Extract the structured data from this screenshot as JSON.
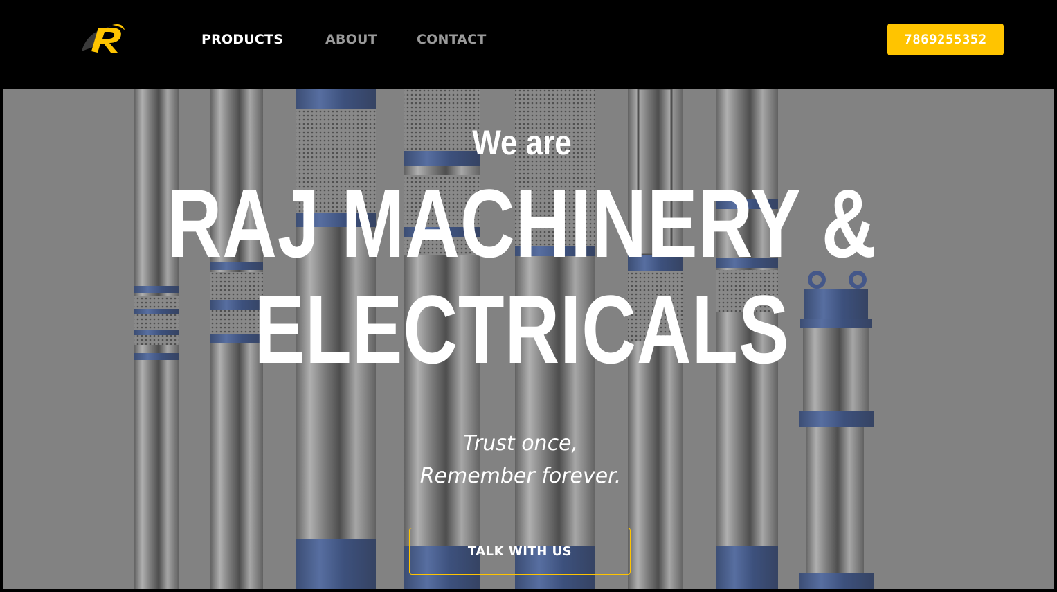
{
  "brand": {
    "logo_letter": "R",
    "accent_color": "#ffc400"
  },
  "nav": {
    "items": [
      {
        "label": "PRODUCTS",
        "active": true
      },
      {
        "label": "ABOUT",
        "active": false
      },
      {
        "label": "CONTACT",
        "active": false
      }
    ],
    "phone": "7869255352"
  },
  "hero": {
    "eyebrow": "We are",
    "title_line1": "RAJ MACHINERY &",
    "title_line2": "ELECTRICALS",
    "tagline_line1": "Trust once,",
    "tagline_line2": "Remember forever.",
    "cta_label": "TALK WITH US"
  }
}
